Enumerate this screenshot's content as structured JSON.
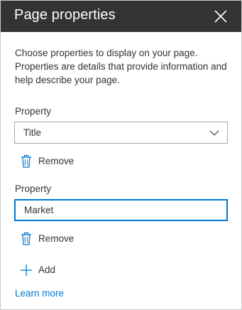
{
  "panel": {
    "title": "Page properties",
    "close_icon": "close-icon",
    "description": "Choose properties to display on your page. Properties are details that provide information and help describe your page."
  },
  "properties": [
    {
      "label": "Property",
      "control": "dropdown",
      "value": "Title",
      "remove_label": "Remove"
    },
    {
      "label": "Property",
      "control": "text-input",
      "value": "Market",
      "remove_label": "Remove"
    }
  ],
  "add_label": "Add",
  "learn_more_label": "Learn more",
  "colors": {
    "header_bg": "#333333",
    "accent": "#0078d4",
    "text": "#333333",
    "border": "#a6a6a6"
  }
}
